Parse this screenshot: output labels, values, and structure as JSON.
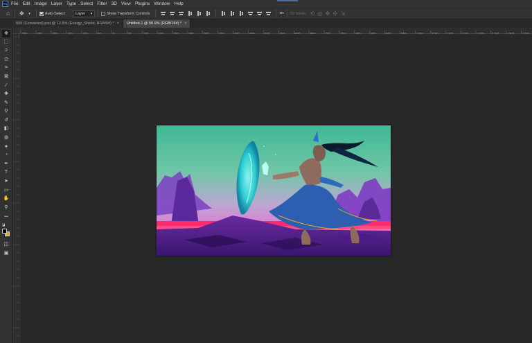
{
  "menubar": {
    "logo": "Ps",
    "items": [
      "File",
      "Edit",
      "Image",
      "Layer",
      "Type",
      "Select",
      "Filter",
      "3D",
      "View",
      "Plugins",
      "Window",
      "Help"
    ]
  },
  "options": {
    "auto_select_label": "Auto-Select:",
    "auto_select_checked": true,
    "layer_select": "Layer",
    "transform_label": "Show Transform Controls",
    "transform_checked": false,
    "mode_3d_label": "3D Mode:",
    "more_label": "•••"
  },
  "tabs": [
    {
      "label": "699 (Converted).psd @ 12.5% (Energy_Shield, RGB/8#) *",
      "active": false
    },
    {
      "label": "Untitled-1 @ 50.9% (RGB/16#) *",
      "active": true
    }
  ],
  "ruler": {
    "ticks": [
      "300",
      "250",
      "200",
      "150",
      "100",
      "50",
      "0",
      "50",
      "100",
      "150",
      "200",
      "250",
      "300",
      "350",
      "400",
      "450",
      "500",
      "550",
      "600",
      "650",
      "700",
      "750",
      "800",
      "850",
      "900",
      "950",
      "1000",
      "1050",
      "1100",
      "1150",
      "1200",
      "1250",
      "1300",
      "1350"
    ]
  },
  "tools": [
    {
      "name": "move-tool",
      "glyph": "✥",
      "active": true
    },
    {
      "name": "marquee-tool",
      "glyph": "⬚"
    },
    {
      "name": "lasso-tool",
      "glyph": "ↄ"
    },
    {
      "name": "magic-wand-tool",
      "glyph": "⚝"
    },
    {
      "name": "crop-tool",
      "glyph": "⌗"
    },
    {
      "name": "frame-tool",
      "glyph": "⊠"
    },
    {
      "name": "eyedropper-tool",
      "glyph": "⁄"
    },
    {
      "name": "healing-brush-tool",
      "glyph": "✚"
    },
    {
      "name": "brush-tool",
      "glyph": "✎"
    },
    {
      "name": "clone-stamp-tool",
      "glyph": "⚲"
    },
    {
      "name": "history-brush-tool",
      "glyph": "↺"
    },
    {
      "name": "eraser-tool",
      "glyph": "◧"
    },
    {
      "name": "paint-bucket-tool",
      "glyph": "◍"
    },
    {
      "name": "blur-tool",
      "glyph": "●"
    },
    {
      "name": "dodge-tool",
      "glyph": "◔"
    },
    {
      "name": "pen-tool",
      "glyph": "✒"
    },
    {
      "name": "type-tool",
      "glyph": "T"
    },
    {
      "name": "path-selection-tool",
      "glyph": "➤"
    },
    {
      "name": "rectangle-tool",
      "glyph": "▭"
    },
    {
      "name": "hand-tool",
      "glyph": "✋"
    },
    {
      "name": "zoom-tool",
      "glyph": "⚲"
    },
    {
      "name": "edit-toolbar",
      "glyph": "•••"
    }
  ],
  "colors": {
    "foreground": "#000000",
    "background": "#f3a21a",
    "workspace": "#282828",
    "panel": "#323232"
  }
}
